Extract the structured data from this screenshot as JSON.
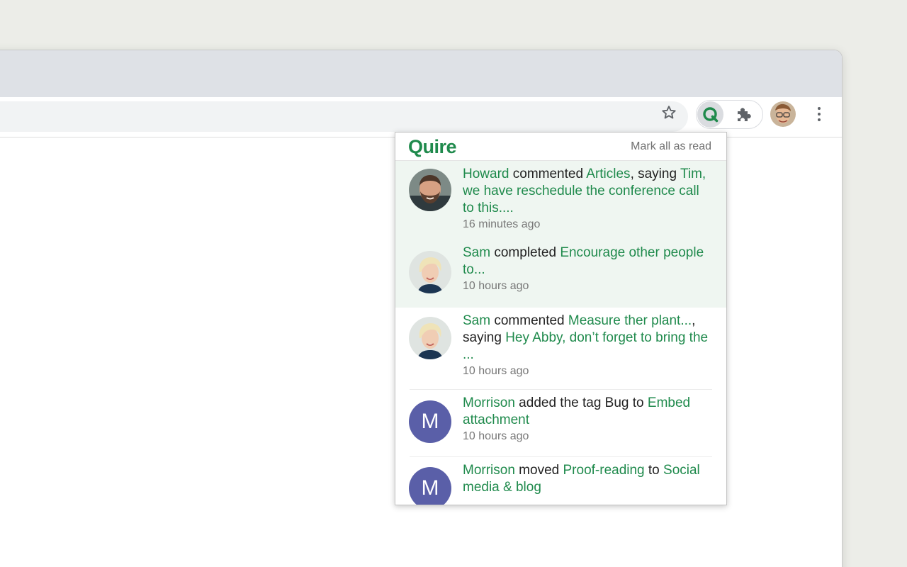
{
  "colors": {
    "brand_green": "#1f8a4c",
    "unread_bg": "#eff6f1",
    "letter_avatar": "#5a5fa8"
  },
  "toolbar": {
    "bookmark_icon": "star-outline-icon",
    "extension_icon": "quire-q-icon",
    "extensions_menu_icon": "puzzle-piece-icon",
    "menu_icon": "three-dots-vertical-icon"
  },
  "popup": {
    "logo": "Quire",
    "mark_all_read": "Mark all as read",
    "items": [
      {
        "user": "Howard",
        "action": " commented ",
        "target": "Articles",
        "connector": ", saying ",
        "quote": "Tim, we have reschedule the conference call to this....",
        "time": "16 minutes ago",
        "unread": true
      },
      {
        "user": "Sam",
        "action": " completed ",
        "target": "Encourage other people to...",
        "time": "10 hours ago",
        "unread": true
      },
      {
        "user": "Sam",
        "action": " commented ",
        "target": "Measure ther plant...",
        "connector": ", saying ",
        "quote": "Hey Abby, don’t forget to bring the ...",
        "time": "10 hours ago",
        "unread": false
      },
      {
        "user": "Morrison",
        "action": " added the tag Bug to ",
        "target": "Embed attachment",
        "time": "10 hours ago",
        "unread": false,
        "avatar_letter": "M"
      },
      {
        "user": "Morrison",
        "action": " moved ",
        "target": "Proof-reading",
        "connector": " to ",
        "quote": "Social media & blog",
        "unread": false,
        "avatar_letter": "M"
      }
    ]
  }
}
